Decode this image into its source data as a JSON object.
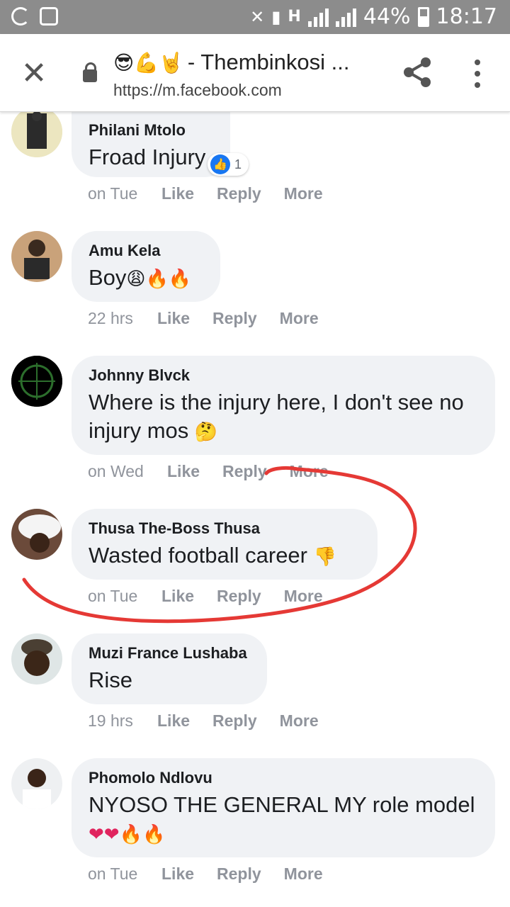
{
  "status_bar": {
    "signal_tag": "H",
    "battery_percent": "44%",
    "time": "18:17"
  },
  "browser": {
    "title_emojis": "😎💪🤘",
    "title": "- Thembinkosi ...",
    "url": "https://m.facebook.com"
  },
  "comments": [
    {
      "author": "Philani Mtolo",
      "text": "Froad Injury",
      "reaction_count": "1",
      "time": "on Tue"
    },
    {
      "author": "Amu Kela",
      "text": "Boy",
      "emojis": "😩🔥🔥",
      "time": "22 hrs"
    },
    {
      "author": "Johnny Blvck",
      "text": "Where is the injury here, I don't see no injury mos",
      "emojis": "🤔",
      "time": "on Wed"
    },
    {
      "author": "Thusa The-Boss Thusa",
      "text": "Wasted football career",
      "emojis": "👎",
      "time": "on Tue"
    },
    {
      "author": "Muzi France Lushaba",
      "text": "Rise",
      "time": "19 hrs"
    },
    {
      "author": "Phomolo Ndlovu",
      "text": "NYOSO THE GENERAL MY role model",
      "emojis": "❤❤🔥🔥",
      "time": "on Tue"
    }
  ],
  "actions": {
    "like": "Like",
    "reply": "Reply",
    "more": "More"
  },
  "colors": {
    "status_bar_bg": "#8c8c8c",
    "bubble_bg": "#f0f2f5",
    "meta_text": "#90949c",
    "like_blue": "#1877f2",
    "annotation_red": "#e53935"
  }
}
